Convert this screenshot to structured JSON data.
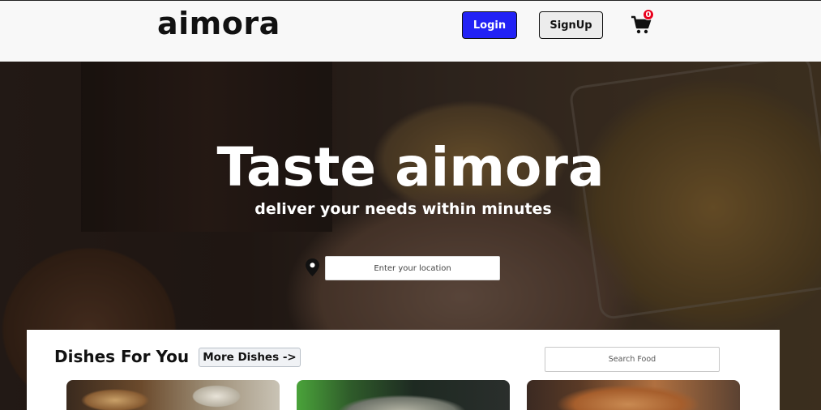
{
  "navbar": {
    "logo": "aimora",
    "login_label": "Login",
    "signup_label": "SignUp",
    "cart_count": "0",
    "colors": {
      "login_bg": "#2222f5",
      "badge": "#e8001c"
    }
  },
  "hero": {
    "title": "Taste aimora",
    "subtitle": "deliver your needs within minutes",
    "location_placeholder": "Enter your location",
    "location_icon": "map-pin-icon"
  },
  "dishes": {
    "section_title": "Dishes For You",
    "more_label": "More Dishes ->",
    "search_placeholder": "Search Food",
    "cards": [
      {
        "name": "dish-card-1"
      },
      {
        "name": "dish-card-2"
      },
      {
        "name": "dish-card-3"
      }
    ]
  }
}
